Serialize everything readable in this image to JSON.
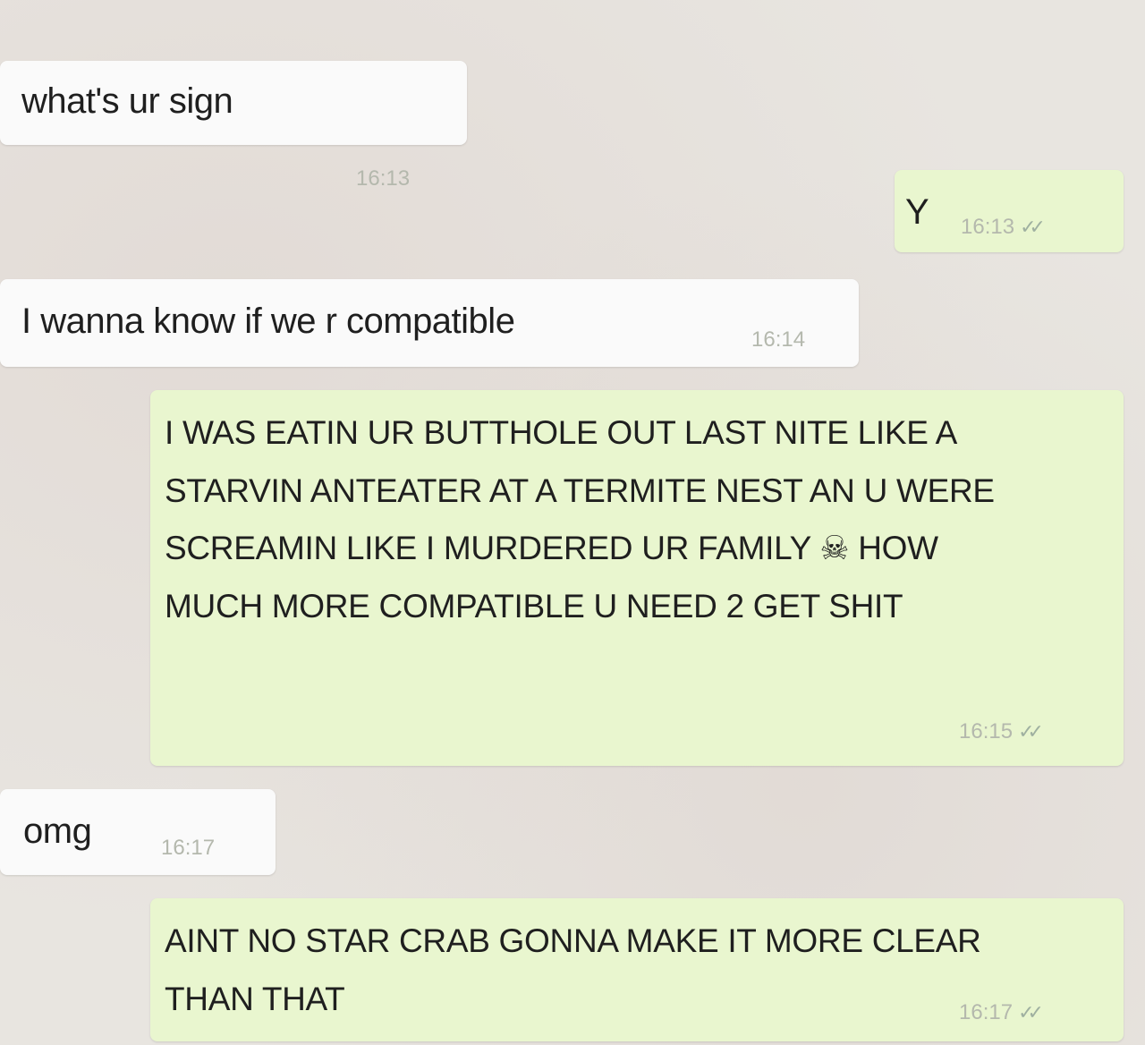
{
  "messages": [
    {
      "direction": "incoming",
      "text": "what's ur sign",
      "time": "16:13"
    },
    {
      "direction": "outgoing",
      "text": "Y",
      "time": "16:13",
      "status_icon": "double-check-icon"
    },
    {
      "direction": "incoming",
      "text": "I wanna know if we r compatible",
      "time": "16:14"
    },
    {
      "direction": "outgoing",
      "text": "I WAS EATIN UR BUTTHOLE OUT LAST NITE LIKE A STARVIN ANTEATER AT A TERMITE NEST AN U WERE SCREAMIN LIKE I MURDERED UR FAMILY ☠ HOW MUCH MORE COMPATIBLE U NEED 2 GET SHIT",
      "time": "16:15",
      "status_icon": "double-check-icon"
    },
    {
      "direction": "incoming",
      "text": "omg",
      "time": "16:17"
    },
    {
      "direction": "outgoing",
      "text": "AINT NO STAR CRAB GONNA MAKE IT MORE CLEAR THAN THAT",
      "time": "16:17",
      "status_icon": "double-check-icon"
    }
  ],
  "colors": {
    "background": "#e8e5e0",
    "incoming_bubble": "#fafafa",
    "outgoing_bubble": "#e9f6cf",
    "timestamp": "#b4b8ad"
  }
}
